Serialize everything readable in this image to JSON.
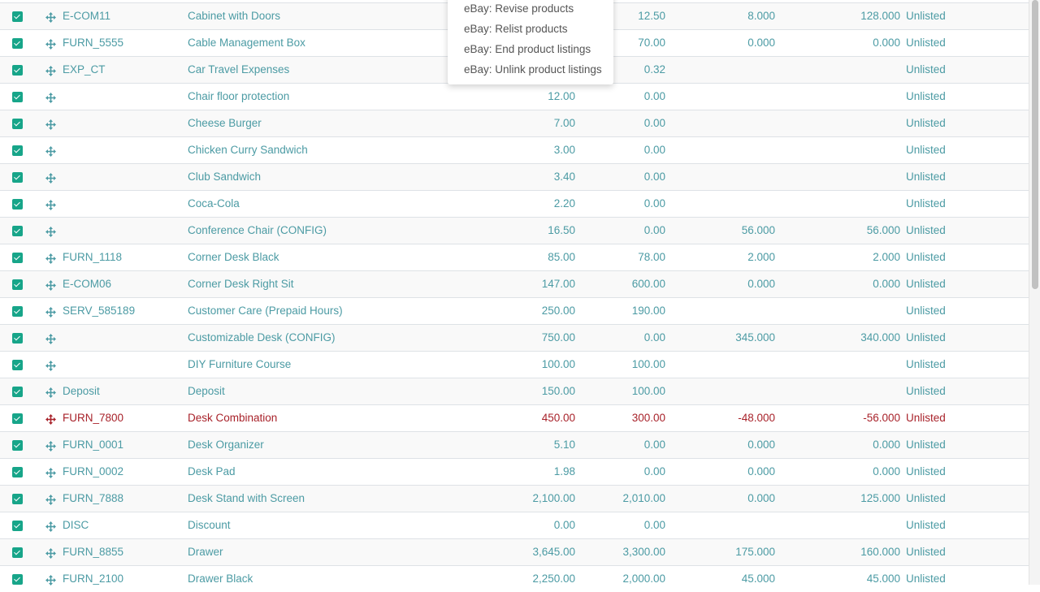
{
  "dropdown_menu": {
    "items": [
      "eBay: Revise products",
      "eBay: Relist products",
      "eBay: End product listings",
      "eBay: Unlink product listings"
    ]
  },
  "colors": {
    "accent": "#4c9ba4",
    "checkbox": "#17a589",
    "danger": "#a8222a"
  },
  "rows": [
    {
      "code": "E-COM11",
      "name": "Cabinet with Doors",
      "price": "",
      "cost": "12.50",
      "onhand": "8.000",
      "forecast": "128.000",
      "status": "Unlisted",
      "danger": false
    },
    {
      "code": "FURN_5555",
      "name": "Cable Management Box",
      "price": "",
      "cost": "70.00",
      "onhand": "0.000",
      "forecast": "0.000",
      "status": "Unlisted",
      "danger": false
    },
    {
      "code": "EXP_CT",
      "name": "Car Travel Expenses",
      "price": "",
      "cost": "0.32",
      "onhand": "",
      "forecast": "",
      "status": "Unlisted",
      "danger": false
    },
    {
      "code": "",
      "name": "Chair floor protection",
      "price": "12.00",
      "cost": "0.00",
      "onhand": "",
      "forecast": "",
      "status": "Unlisted",
      "danger": false
    },
    {
      "code": "",
      "name": "Cheese Burger",
      "price": "7.00",
      "cost": "0.00",
      "onhand": "",
      "forecast": "",
      "status": "Unlisted",
      "danger": false
    },
    {
      "code": "",
      "name": "Chicken Curry Sandwich",
      "price": "3.00",
      "cost": "0.00",
      "onhand": "",
      "forecast": "",
      "status": "Unlisted",
      "danger": false
    },
    {
      "code": "",
      "name": "Club Sandwich",
      "price": "3.40",
      "cost": "0.00",
      "onhand": "",
      "forecast": "",
      "status": "Unlisted",
      "danger": false
    },
    {
      "code": "",
      "name": "Coca-Cola",
      "price": "2.20",
      "cost": "0.00",
      "onhand": "",
      "forecast": "",
      "status": "Unlisted",
      "danger": false
    },
    {
      "code": "",
      "name": "Conference Chair (CONFIG)",
      "price": "16.50",
      "cost": "0.00",
      "onhand": "56.000",
      "forecast": "56.000",
      "status": "Unlisted",
      "danger": false
    },
    {
      "code": "FURN_1118",
      "name": "Corner Desk Black",
      "price": "85.00",
      "cost": "78.00",
      "onhand": "2.000",
      "forecast": "2.000",
      "status": "Unlisted",
      "danger": false
    },
    {
      "code": "E-COM06",
      "name": "Corner Desk Right Sit",
      "price": "147.00",
      "cost": "600.00",
      "onhand": "0.000",
      "forecast": "0.000",
      "status": "Unlisted",
      "danger": false
    },
    {
      "code": "SERV_585189",
      "name": "Customer Care (Prepaid Hours)",
      "price": "250.00",
      "cost": "190.00",
      "onhand": "",
      "forecast": "",
      "status": "Unlisted",
      "danger": false
    },
    {
      "code": "",
      "name": "Customizable Desk (CONFIG)",
      "price": "750.00",
      "cost": "0.00",
      "onhand": "345.000",
      "forecast": "340.000",
      "status": "Unlisted",
      "danger": false
    },
    {
      "code": "",
      "name": "DIY Furniture Course",
      "price": "100.00",
      "cost": "100.00",
      "onhand": "",
      "forecast": "",
      "status": "Unlisted",
      "danger": false
    },
    {
      "code": "Deposit",
      "name": "Deposit",
      "price": "150.00",
      "cost": "100.00",
      "onhand": "",
      "forecast": "",
      "status": "Unlisted",
      "danger": false
    },
    {
      "code": "FURN_7800",
      "name": "Desk Combination",
      "price": "450.00",
      "cost": "300.00",
      "onhand": "-48.000",
      "forecast": "-56.000",
      "status": "Unlisted",
      "danger": true
    },
    {
      "code": "FURN_0001",
      "name": "Desk Organizer",
      "price": "5.10",
      "cost": "0.00",
      "onhand": "0.000",
      "forecast": "0.000",
      "status": "Unlisted",
      "danger": false
    },
    {
      "code": "FURN_0002",
      "name": "Desk Pad",
      "price": "1.98",
      "cost": "0.00",
      "onhand": "0.000",
      "forecast": "0.000",
      "status": "Unlisted",
      "danger": false
    },
    {
      "code": "FURN_7888",
      "name": "Desk Stand with Screen",
      "price": "2,100.00",
      "cost": "2,010.00",
      "onhand": "0.000",
      "forecast": "125.000",
      "status": "Unlisted",
      "danger": false
    },
    {
      "code": "DISC",
      "name": "Discount",
      "price": "0.00",
      "cost": "0.00",
      "onhand": "",
      "forecast": "",
      "status": "Unlisted",
      "danger": false
    },
    {
      "code": "FURN_8855",
      "name": "Drawer",
      "price": "3,645.00",
      "cost": "3,300.00",
      "onhand": "175.000",
      "forecast": "160.000",
      "status": "Unlisted",
      "danger": false
    },
    {
      "code": "FURN_2100",
      "name": "Drawer Black",
      "price": "2,250.00",
      "cost": "2,000.00",
      "onhand": "45.000",
      "forecast": "45.000",
      "status": "Unlisted",
      "danger": false
    }
  ]
}
